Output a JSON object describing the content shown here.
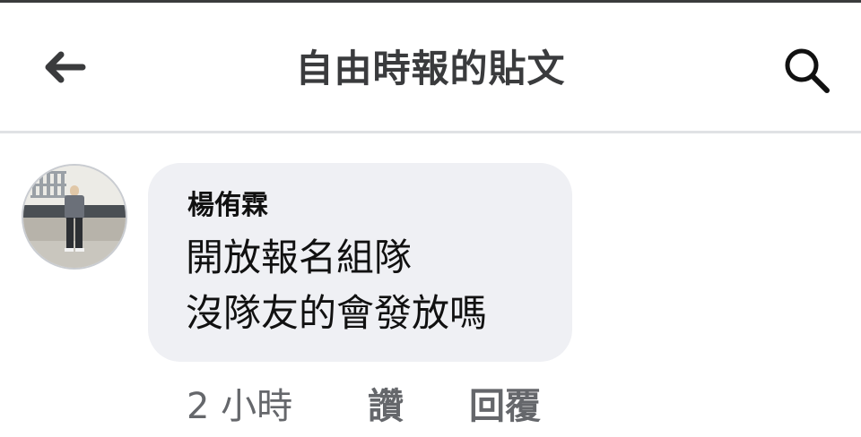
{
  "header": {
    "title": "自由時報的貼文",
    "back_icon": "arrow-left-icon",
    "search_icon": "search-icon"
  },
  "comment": {
    "author": "楊侑霖",
    "lines": [
      "開放報名組隊",
      "沒隊友的會發放嗎"
    ],
    "avatar_icon": "user-photo-avatar"
  },
  "actions": {
    "time": "2 小時",
    "like_label": "讚",
    "reply_label": "回覆"
  },
  "colors": {
    "title_text": "#3a3b3d",
    "bubble_bg": "#eff0f4",
    "meta_text": "#65676b",
    "divider": "#e0e2e5"
  }
}
